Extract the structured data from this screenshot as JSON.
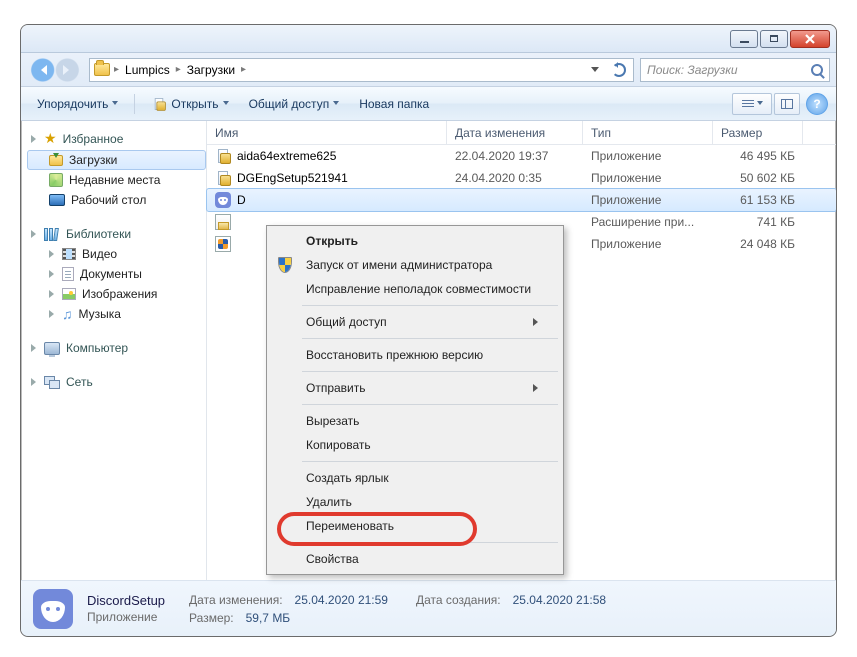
{
  "address": {
    "crumb1": "Lumpics",
    "crumb2": "Загрузки"
  },
  "search": {
    "placeholder": "Поиск: Загрузки"
  },
  "toolbar": {
    "organize": "Упорядочить",
    "open": "Открыть",
    "share": "Общий доступ",
    "newfolder": "Новая папка"
  },
  "sidebar": {
    "favorites": "Избранное",
    "downloads": "Загрузки",
    "recent": "Недавние места",
    "desktop": "Рабочий стол",
    "libraries": "Библиотеки",
    "video": "Видео",
    "documents": "Документы",
    "images": "Изображения",
    "music": "Музыка",
    "computer": "Компьютер",
    "network": "Сеть"
  },
  "columns": {
    "name": "Имя",
    "date": "Дата изменения",
    "type": "Тип",
    "size": "Размер"
  },
  "files": [
    {
      "name": "aida64extreme625",
      "date": "22.04.2020 19:37",
      "type": "Приложение",
      "size": "46 495 КБ"
    },
    {
      "name": "DGEngSetup521941",
      "date": "24.04.2020 0:35",
      "type": "Приложение",
      "size": "50 602 КБ"
    },
    {
      "name": "D",
      "date": "",
      "type": "Приложение",
      "size": "61 153 КБ"
    },
    {
      "name": "",
      "date": "",
      "type": "Расширение при...",
      "size": "741 КБ"
    },
    {
      "name": "",
      "date": "",
      "type": "Приложение",
      "size": "24 048 КБ"
    }
  ],
  "ctx": {
    "open": "Открыть",
    "runas": "Запуск от имени администратора",
    "troubleshoot": "Исправление неполадок совместимости",
    "share": "Общий доступ",
    "restore": "Восстановить прежнюю версию",
    "sendto": "Отправить",
    "cut": "Вырезать",
    "copy": "Копировать",
    "shortcut": "Создать ярлык",
    "delete": "Удалить",
    "rename": "Переименовать",
    "properties": "Свойства"
  },
  "details": {
    "name": "DiscordSetup",
    "type": "Приложение",
    "mod_label": "Дата изменения:",
    "mod_value": "25.04.2020 21:59",
    "size_label": "Размер:",
    "size_value": "59,7 МБ",
    "created_label": "Дата создания:",
    "created_value": "25.04.2020 21:58"
  }
}
